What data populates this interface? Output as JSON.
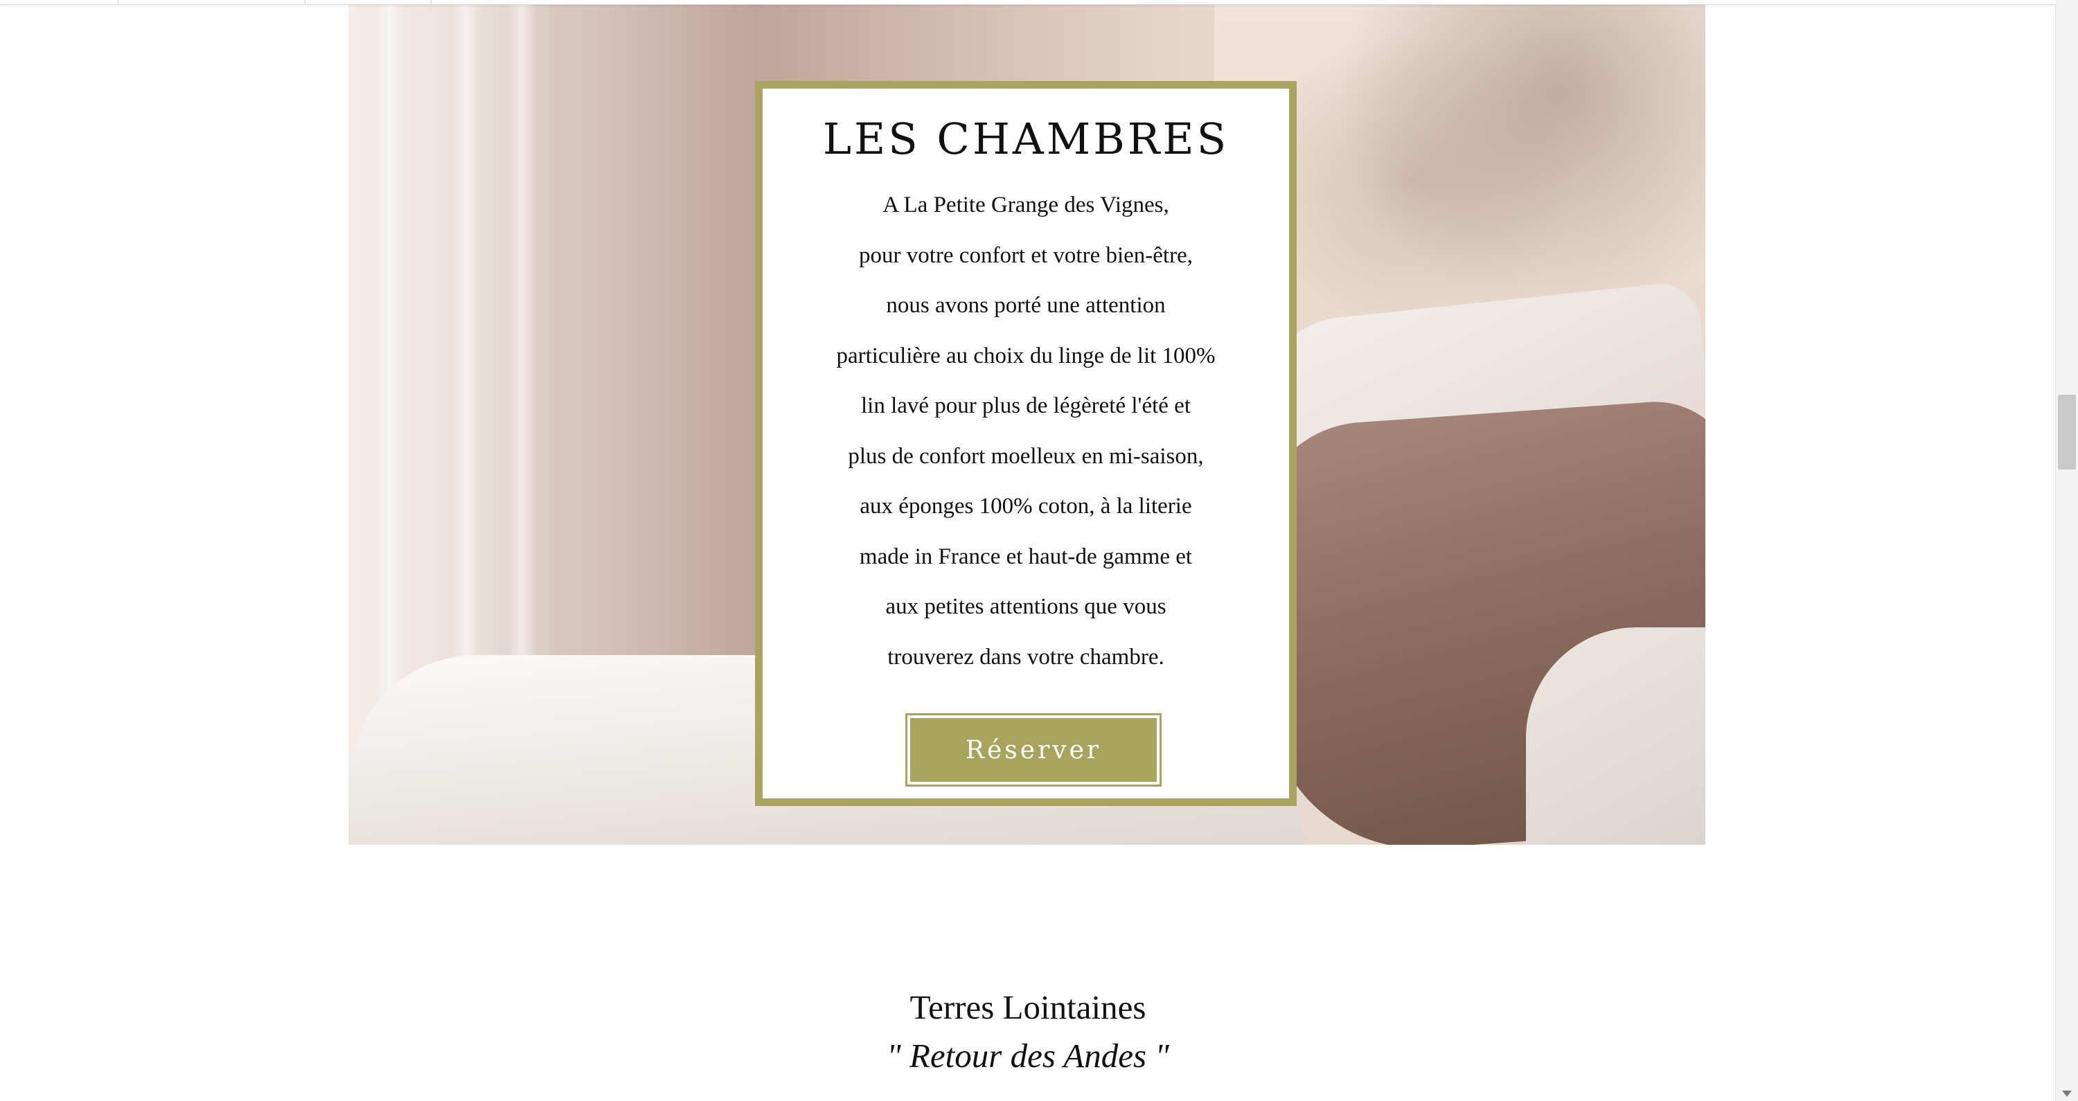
{
  "hero": {
    "image_name": "bedroom-linen-photo",
    "card": {
      "title": "LES  CHAMBRES",
      "lines": [
        "A La Petite Grange des Vignes,",
        "pour votre confort et votre bien-être,",
        "nous avons porté une attention",
        "particulière au choix du linge de lit 100%",
        "lin lavé pour plus de légèreté l'été et",
        "plus de confort moelleux en mi-saison,",
        "aux éponges 100% coton, à la literie",
        "made in France et haut-de gamme et",
        "aux petites attentions que vous",
        "trouverez dans votre chambre."
      ],
      "button_label": "Réserver",
      "border_color": "#a9a45d"
    }
  },
  "section": {
    "title": "Terres Lointaines",
    "subtitle": "\" Retour des Andes \""
  },
  "scrollbar": {
    "arrow_icon": "chevron-down-icon"
  }
}
